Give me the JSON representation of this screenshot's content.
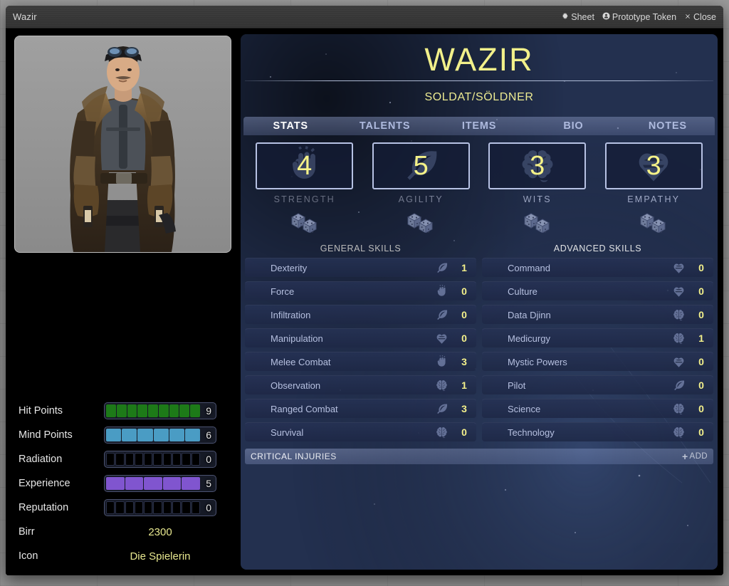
{
  "window": {
    "title": "Wazir",
    "controls": [
      {
        "icon": "gear-icon",
        "glyph": "⚙",
        "label": "Sheet"
      },
      {
        "icon": "user-token-icon",
        "glyph": "⚫",
        "label": "Prototype Token"
      },
      {
        "icon": "close-icon",
        "glyph": "✖",
        "label": "Close"
      }
    ]
  },
  "character": {
    "name": "WAZIR",
    "archetype": "SOLDAT/SÖLDNER",
    "portrait_alt": "character-portrait"
  },
  "tabs": [
    {
      "label": "STATS",
      "active": true
    },
    {
      "label": "TALENTS",
      "active": false
    },
    {
      "label": "ITEMS",
      "active": false
    },
    {
      "label": "BIO",
      "active": false
    },
    {
      "label": "NOTES",
      "active": false
    }
  ],
  "attributes": [
    {
      "name": "STRENGTH",
      "value": "4",
      "icon": "fist-icon"
    },
    {
      "name": "AGILITY",
      "value": "5",
      "icon": "feather-icon"
    },
    {
      "name": "WITS",
      "value": "3",
      "icon": "brain-icon"
    },
    {
      "name": "EMPATHY",
      "value": "3",
      "icon": "heart-icon"
    }
  ],
  "skills": {
    "general_header": "GENERAL SKILLS",
    "advanced_header": "ADVANCED SKILLS",
    "general": [
      {
        "name": "Dexterity",
        "value": "1",
        "icon": "feather-icon"
      },
      {
        "name": "Force",
        "value": "0",
        "icon": "fist-icon"
      },
      {
        "name": "Infiltration",
        "value": "0",
        "icon": "feather-icon"
      },
      {
        "name": "Manipulation",
        "value": "0",
        "icon": "heart-icon"
      },
      {
        "name": "Melee Combat",
        "value": "3",
        "icon": "fist-icon"
      },
      {
        "name": "Observation",
        "value": "1",
        "icon": "brain-icon"
      },
      {
        "name": "Ranged Combat",
        "value": "3",
        "icon": "feather-icon"
      },
      {
        "name": "Survival",
        "value": "0",
        "icon": "brain-icon"
      }
    ],
    "advanced": [
      {
        "name": "Command",
        "value": "0",
        "icon": "heart-icon"
      },
      {
        "name": "Culture",
        "value": "0",
        "icon": "heart-icon"
      },
      {
        "name": "Data Djinn",
        "value": "0",
        "icon": "brain-icon"
      },
      {
        "name": "Medicurgy",
        "value": "1",
        "icon": "brain-icon"
      },
      {
        "name": "Mystic Powers",
        "value": "0",
        "icon": "heart-icon"
      },
      {
        "name": "Pilot",
        "value": "0",
        "icon": "feather-icon"
      },
      {
        "name": "Science",
        "value": "0",
        "icon": "brain-icon"
      },
      {
        "name": "Technology",
        "value": "0",
        "icon": "brain-icon"
      }
    ]
  },
  "critical_injuries": {
    "title": "CRITICAL INJURIES",
    "add_label": "ADD",
    "add_icon": "plus-icon"
  },
  "resources": [
    {
      "label": "Hit Points",
      "value": "9",
      "max": 9,
      "filled": 9,
      "color": "#1d7a18"
    },
    {
      "label": "Mind Points",
      "value": "6",
      "max": 6,
      "filled": 6,
      "color": "#4a9cc4"
    },
    {
      "label": "Radiation",
      "value": "0",
      "max": 10,
      "filled": 0,
      "color": "#6fdc6f"
    },
    {
      "label": "Experience",
      "value": "5",
      "max": 5,
      "filled": 5,
      "color": "#8055cf"
    },
    {
      "label": "Reputation",
      "value": "0",
      "max": 10,
      "filled": 0,
      "color": "#c0a030"
    }
  ],
  "fields": [
    {
      "label": "Birr",
      "value": "2300"
    },
    {
      "label": "Icon",
      "value": "Die Spielerin"
    }
  ],
  "colors": {
    "accent_yellow": "#f2f08a",
    "panel_blue": "#23304f",
    "tab_active": "#ffffff",
    "tab_inactive": "#aebade",
    "skill_text": "#b6c0e0"
  }
}
